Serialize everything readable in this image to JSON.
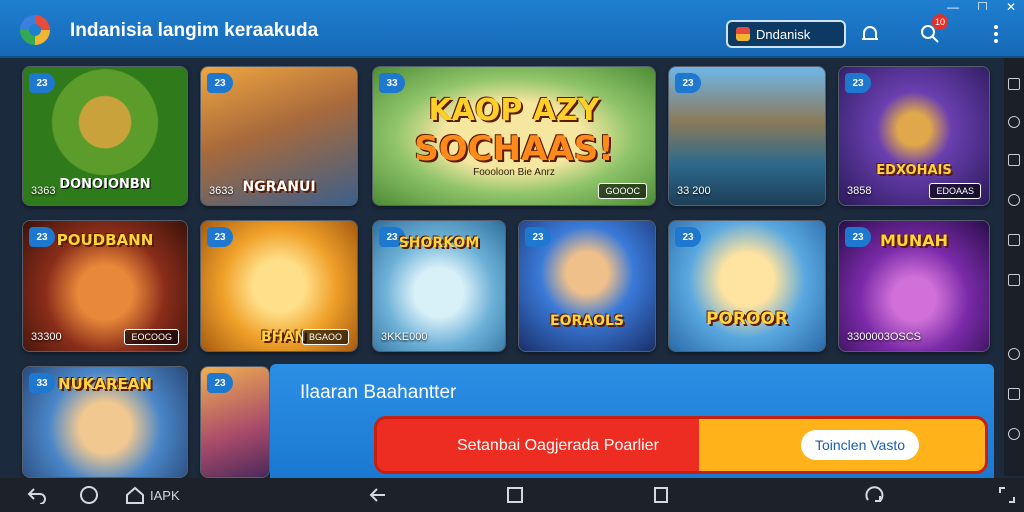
{
  "header": {
    "title": "Indanisia langim keraakuda",
    "language_label": "Dndanisk",
    "notification_count": "10"
  },
  "cards": [
    {
      "num": "23",
      "title": "DONOIONBN",
      "price": "3363",
      "tag": ""
    },
    {
      "num": "23",
      "title": "NGRANUI",
      "price": "3633",
      "tag": ""
    },
    {
      "num": "33",
      "title": "KAOP AZY",
      "title2": "SOCHAAS!",
      "subtitle": "Foooloon Bie Anrz",
      "price": "",
      "tag": "GOOOC"
    },
    {
      "num": "23",
      "title": "",
      "price": "33 200",
      "tag": ""
    },
    {
      "num": "23",
      "title": "EDXOHAIS",
      "price": "3858",
      "tag": "EDOAAS"
    },
    {
      "num": "23",
      "title": "POUDBANN",
      "price": "33300",
      "tag": "EOCOOG"
    },
    {
      "num": "23",
      "title": "BHAN",
      "price": "",
      "tag": "BGAOO"
    },
    {
      "num": "23",
      "title": "SHORKOM",
      "price": "3KKE000",
      "tag": ""
    },
    {
      "num": "23",
      "title": "EORAOLS",
      "price": "",
      "tag": ""
    },
    {
      "num": "23",
      "title": "POROOR",
      "price": "",
      "tag": ""
    },
    {
      "num": "23",
      "title": "MUNAH",
      "price": "3300003OSCS",
      "tag": ""
    },
    {
      "num": "33",
      "title": "NUKAREAN",
      "price": "",
      "tag": ""
    },
    {
      "num": "23",
      "title": "",
      "price": "",
      "tag": ""
    }
  ],
  "panel": {
    "title": "Ilaaran Baahantter",
    "cta_text": "Setanbai Oagjerada Poarlier",
    "cta_button": "Toinclen Vasto"
  },
  "navbar": {
    "apk_label": "IAPK"
  },
  "colors": {
    "header_blue": "#1f7fd0",
    "cta_red": "#ee2d22",
    "cta_orange": "#ffb21a"
  }
}
